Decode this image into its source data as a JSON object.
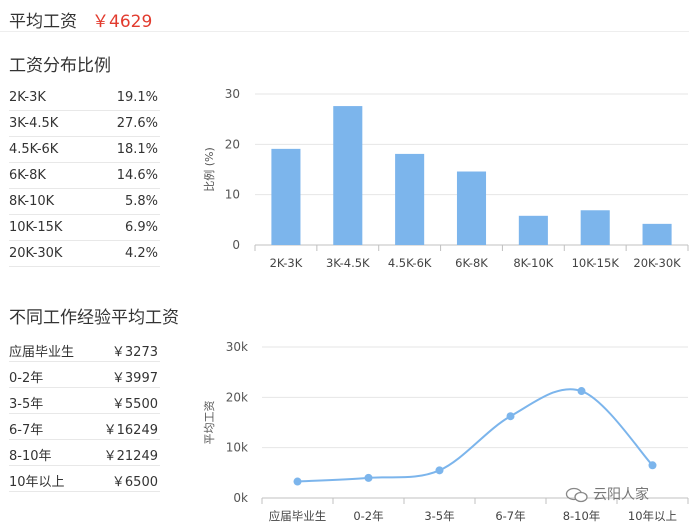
{
  "header": {
    "label": "平均工资",
    "value": "￥4629"
  },
  "salary_section": {
    "title": "工资分布比例",
    "rows": [
      {
        "range": "2K-3K",
        "pct": "19.1%"
      },
      {
        "range": "3K-4.5K",
        "pct": "27.6%"
      },
      {
        "range": "4.5K-6K",
        "pct": "18.1%"
      },
      {
        "range": "6K-8K",
        "pct": "14.6%"
      },
      {
        "range": "8K-10K",
        "pct": "5.8%"
      },
      {
        "range": "10K-15K",
        "pct": "6.9%"
      },
      {
        "range": "20K-30K",
        "pct": "4.2%"
      }
    ]
  },
  "experience_section": {
    "title": "不同工作经验平均工资",
    "rows": [
      {
        "exp": "应届毕业生",
        "salary": "￥3273"
      },
      {
        "exp": "0-2年",
        "salary": "￥3997"
      },
      {
        "exp": "3-5年",
        "salary": "￥5500"
      },
      {
        "exp": "6-7年",
        "salary": "￥16249"
      },
      {
        "exp": "8-10年",
        "salary": "￥21249"
      },
      {
        "exp": "10年以上",
        "salary": "￥6500"
      }
    ]
  },
  "watermark": {
    "text": "云阳人家",
    "icon": "wechat-icon"
  },
  "chart_data": [
    {
      "type": "bar",
      "categories": [
        "2K-3K",
        "3K-4.5K",
        "4.5K-6K",
        "6K-8K",
        "8K-10K",
        "10K-15K",
        "20K-30K"
      ],
      "values": [
        19.1,
        27.6,
        18.1,
        14.6,
        5.8,
        6.9,
        4.2
      ],
      "ylabel": "比例 (%)",
      "ylim": [
        0,
        30
      ],
      "yticks": [
        "0",
        "10",
        "20",
        "30"
      ],
      "color": "#7cb5ec",
      "grid": true
    },
    {
      "type": "line",
      "categories": [
        "应届毕业生",
        "0-2年",
        "3-5年",
        "6-7年",
        "8-10年",
        "10年以上"
      ],
      "values": [
        3273,
        3997,
        5500,
        16249,
        21249,
        6500
      ],
      "ylabel": "平均工资",
      "ylim": [
        0,
        30000
      ],
      "yticks": [
        "0k",
        "10k",
        "20k",
        "30k"
      ],
      "color": "#7cb5ec",
      "smooth": true,
      "grid": true
    }
  ]
}
